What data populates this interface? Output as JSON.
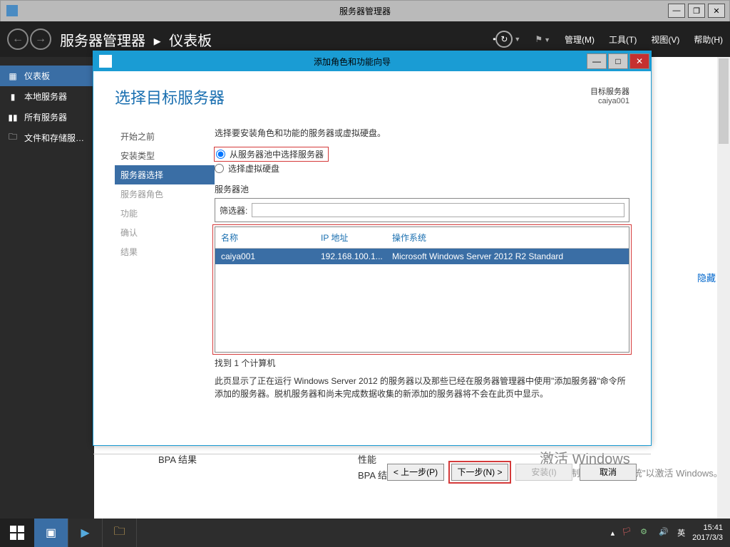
{
  "outer_window": {
    "title": "服务器管理器",
    "minimize": "—",
    "maximize": "❐",
    "close": "✕"
  },
  "header": {
    "breadcrumb_app": "服务器管理器",
    "breadcrumb_page": "仪表板",
    "menu_manage": "管理(M)",
    "menu_tools": "工具(T)",
    "menu_view": "视图(V)",
    "menu_help": "帮助(H)"
  },
  "sidebar": {
    "items": [
      {
        "icon": "▦",
        "label": "仪表板",
        "active": true
      },
      {
        "icon": "▮",
        "label": "本地服务器"
      },
      {
        "icon": "▮▮",
        "label": "所有服务器"
      },
      {
        "icon": "🗀",
        "label": "文件和存储服…"
      }
    ]
  },
  "background": {
    "hidden_link": "隐藏",
    "bpa1": "BPA 结果",
    "perf": "性能",
    "bpa2": "BPA 结果",
    "activate_title": "激活 Windows",
    "activate_sub": "转到\"控制面板\"中的\"系统\"以激活 Windows。"
  },
  "wizard": {
    "title": "添加角色和功能向导",
    "main_title": "选择目标服务器",
    "target_label": "目标服务器",
    "target_value": "caiya001",
    "steps": [
      {
        "label": "开始之前",
        "state": "done"
      },
      {
        "label": "安装类型",
        "state": "done"
      },
      {
        "label": "服务器选择",
        "state": "active"
      },
      {
        "label": "服务器角色",
        "state": "pending"
      },
      {
        "label": "功能",
        "state": "pending"
      },
      {
        "label": "确认",
        "state": "pending"
      },
      {
        "label": "结果",
        "state": "pending"
      }
    ],
    "instruction": "选择要安装角色和功能的服务器或虚拟硬盘。",
    "radio_pool": "从服务器池中选择服务器",
    "radio_vhd": "选择虚拟硬盘",
    "pool_label": "服务器池",
    "filter_label": "筛选器:",
    "filter_value": "",
    "columns": {
      "name": "名称",
      "ip": "IP 地址",
      "os": "操作系统"
    },
    "rows": [
      {
        "name": "caiya001",
        "ip": "192.168.100.1...",
        "os": "Microsoft Windows Server 2012 R2 Standard"
      }
    ],
    "found_text": "找到 1 个计算机",
    "footnote": "此页显示了正在运行 Windows Server 2012 的服务器以及那些已经在服务器管理器中使用\"添加服务器\"命令所添加的服务器。脱机服务器和尚未完成数据收集的新添加的服务器将不会在此页中显示。",
    "buttons": {
      "prev": "< 上一步(P)",
      "next": "下一步(N) >",
      "install": "安装(I)",
      "cancel": "取消"
    }
  },
  "taskbar": {
    "ime": "英",
    "time": "15:41",
    "date": "2017/3/3"
  }
}
